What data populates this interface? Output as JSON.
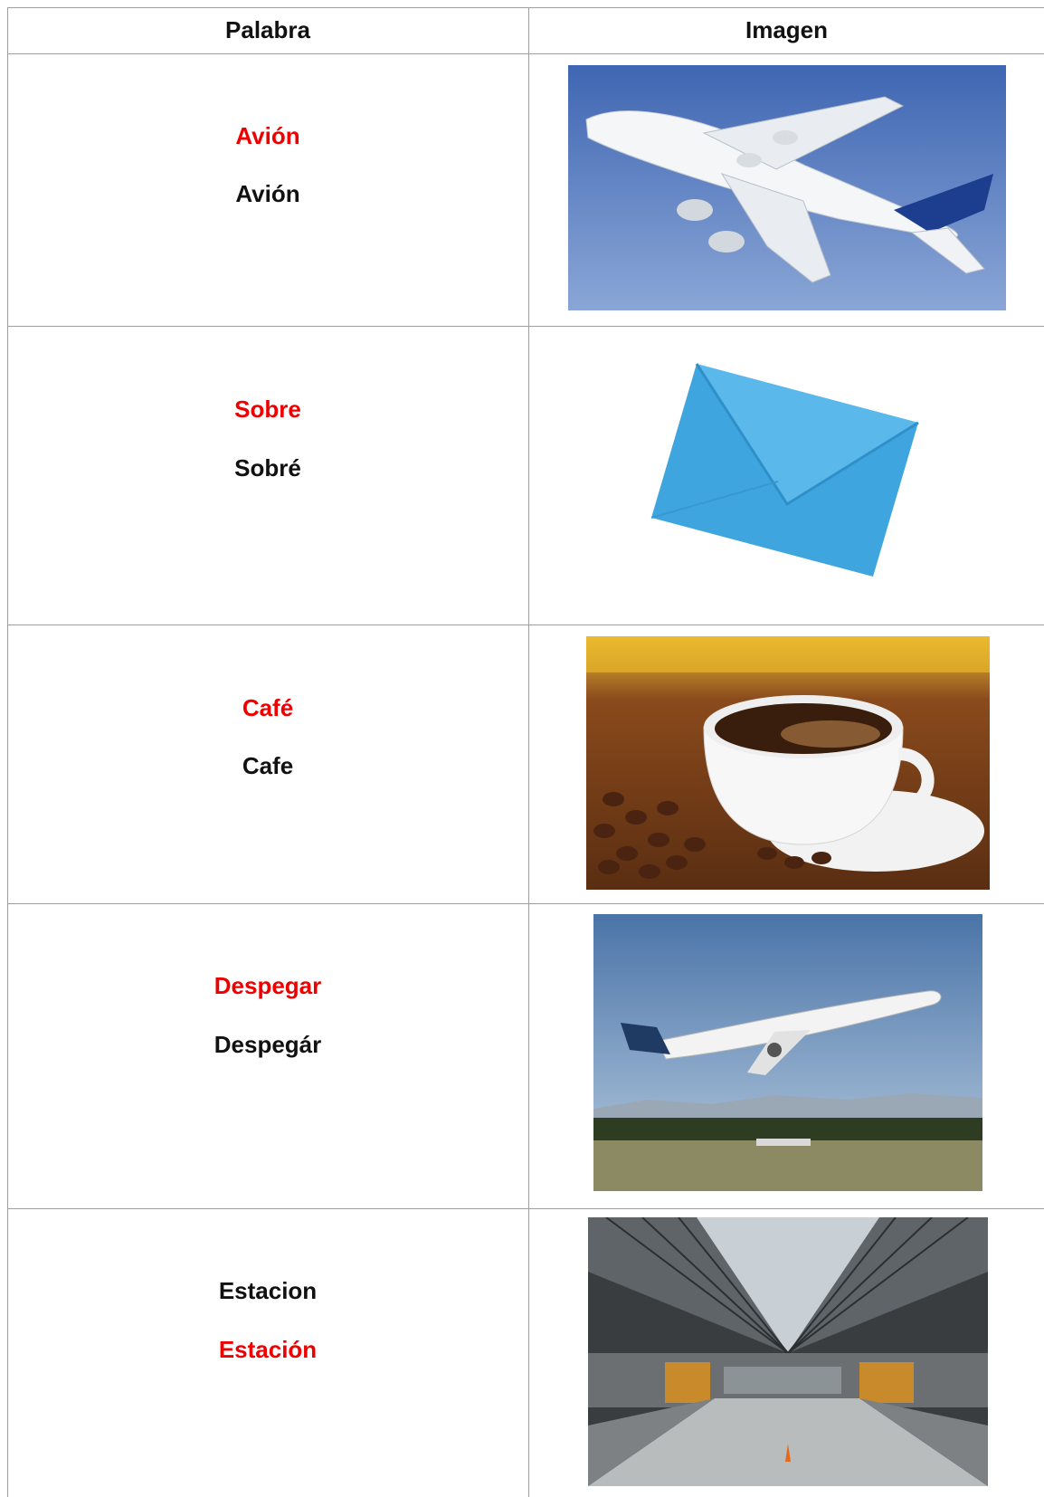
{
  "table": {
    "headers": {
      "word": "Palabra",
      "image": "Imagen"
    },
    "rows": [
      {
        "lines": [
          "Avión",
          "Avión"
        ],
        "image": "airplane-photo"
      },
      {
        "lines": [
          "Sobre",
          "Sobré"
        ],
        "image": "envelope-photo"
      },
      {
        "lines": [
          "Café",
          "Cafe"
        ],
        "image": "coffee-cup-photo"
      },
      {
        "lines": [
          "Despegar",
          "Despegár"
        ],
        "image": "airplane-takeoff-photo"
      },
      {
        "lines": [
          "Estacion",
          "Estación"
        ],
        "image": "train-station-photo"
      }
    ]
  },
  "colors": {
    "correct": "#ef0000",
    "text": "#111111",
    "border": "#9e9e9e"
  }
}
